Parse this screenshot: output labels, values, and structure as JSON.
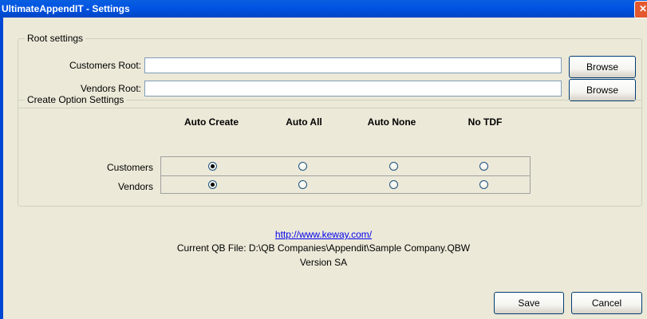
{
  "window": {
    "title": "UltimateAppendIT - Settings",
    "close_glyph": "✕"
  },
  "root_settings": {
    "legend": "Root settings",
    "customers_label": "Customers Root:",
    "customers_value": "",
    "vendors_label": "Vendors Root:",
    "vendors_value": "",
    "browse_label": "Browse"
  },
  "create_options": {
    "legend": "Create Option Settings",
    "columns": [
      "Auto Create",
      "Auto All",
      "Auto None",
      "No TDF"
    ],
    "rows": [
      {
        "label": "Customers",
        "selected": "Auto Create"
      },
      {
        "label": "Vendors",
        "selected": "Auto Create"
      }
    ]
  },
  "info": {
    "url": "http://www.keway.com/",
    "current_file": "Current QB File: D:\\QB Companies\\Appendit\\Sample Company.QBW",
    "version": "Version SA"
  },
  "footer": {
    "save_label": "Save",
    "cancel_label": "Cancel"
  }
}
